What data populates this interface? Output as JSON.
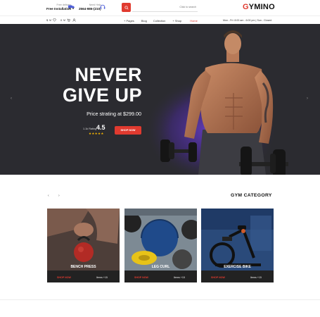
{
  "header": {
    "delivery": {
      "small": "Free delivery",
      "big": "Free Installation"
    },
    "support": {
      "small": "Need Help",
      "big": "2564-986-(210)"
    },
    "search": {
      "placeholder": "Click to search"
    },
    "logo": {
      "first": "G",
      "rest": "YMINO"
    }
  },
  "nav": {
    "currency": "$",
    "lang": "EN",
    "links": {
      "pages": "+ Pages",
      "blog": "Blog",
      "collections": "Collection",
      "shop": "+ Shop",
      "home": "Home"
    },
    "hours": "Mon - Fri: 8:00 am - 6:00 pm | Sun - Closed"
  },
  "hero": {
    "headline_1": "NEVER",
    "headline_2": "GIVE UP",
    "price_text": "Price strating at $299.00",
    "rating_label": "1.1k Rating",
    "rating_value": "4.5",
    "stars": "★★★★★",
    "cta": "SHOP NOW",
    "prev": "‹",
    "next": "›"
  },
  "category": {
    "title": "GYM CATEGORY",
    "prev": "‹",
    "next": "›",
    "cards": [
      {
        "name": "BENCH PRESS",
        "shop": "SHOP NOW",
        "items": "Items +15"
      },
      {
        "name": "LEG CURL",
        "shop": "SHOP NOW",
        "items": "Items +15"
      },
      {
        "name": "EXERCISE BIKE",
        "shop": "SHOP NOW",
        "items": "Items +15"
      }
    ]
  },
  "colors": {
    "accent": "#e03a2f",
    "dark": "#2a2a2e",
    "star": "#f5b400"
  }
}
